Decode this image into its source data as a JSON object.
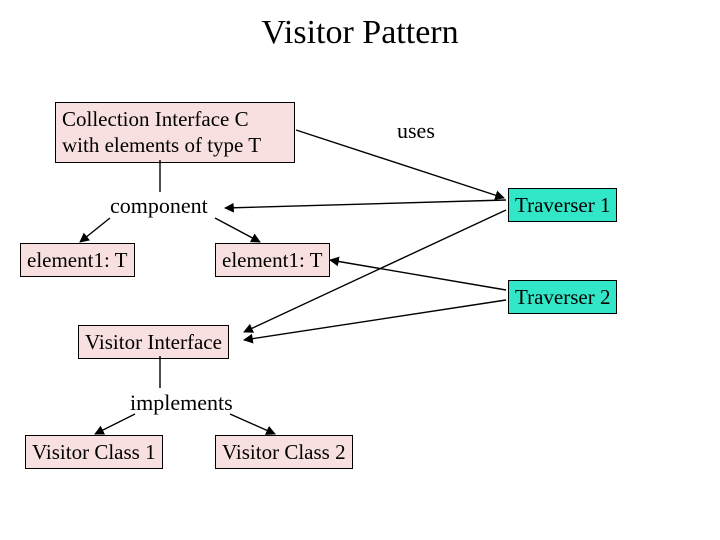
{
  "title": "Visitor Pattern",
  "collection": {
    "line1": "Collection Interface C",
    "line2": "with elements of type T"
  },
  "labels": {
    "uses": "uses",
    "component": "component",
    "implements": "implements"
  },
  "element1": "element1: T",
  "element2": "element1: T",
  "traverser1": "Traverser 1",
  "traverser2": "Traverser 2",
  "visitorInterface": "Visitor Interface",
  "visitorClass1": "Visitor Class 1",
  "visitorClass2": "Visitor Class 2"
}
